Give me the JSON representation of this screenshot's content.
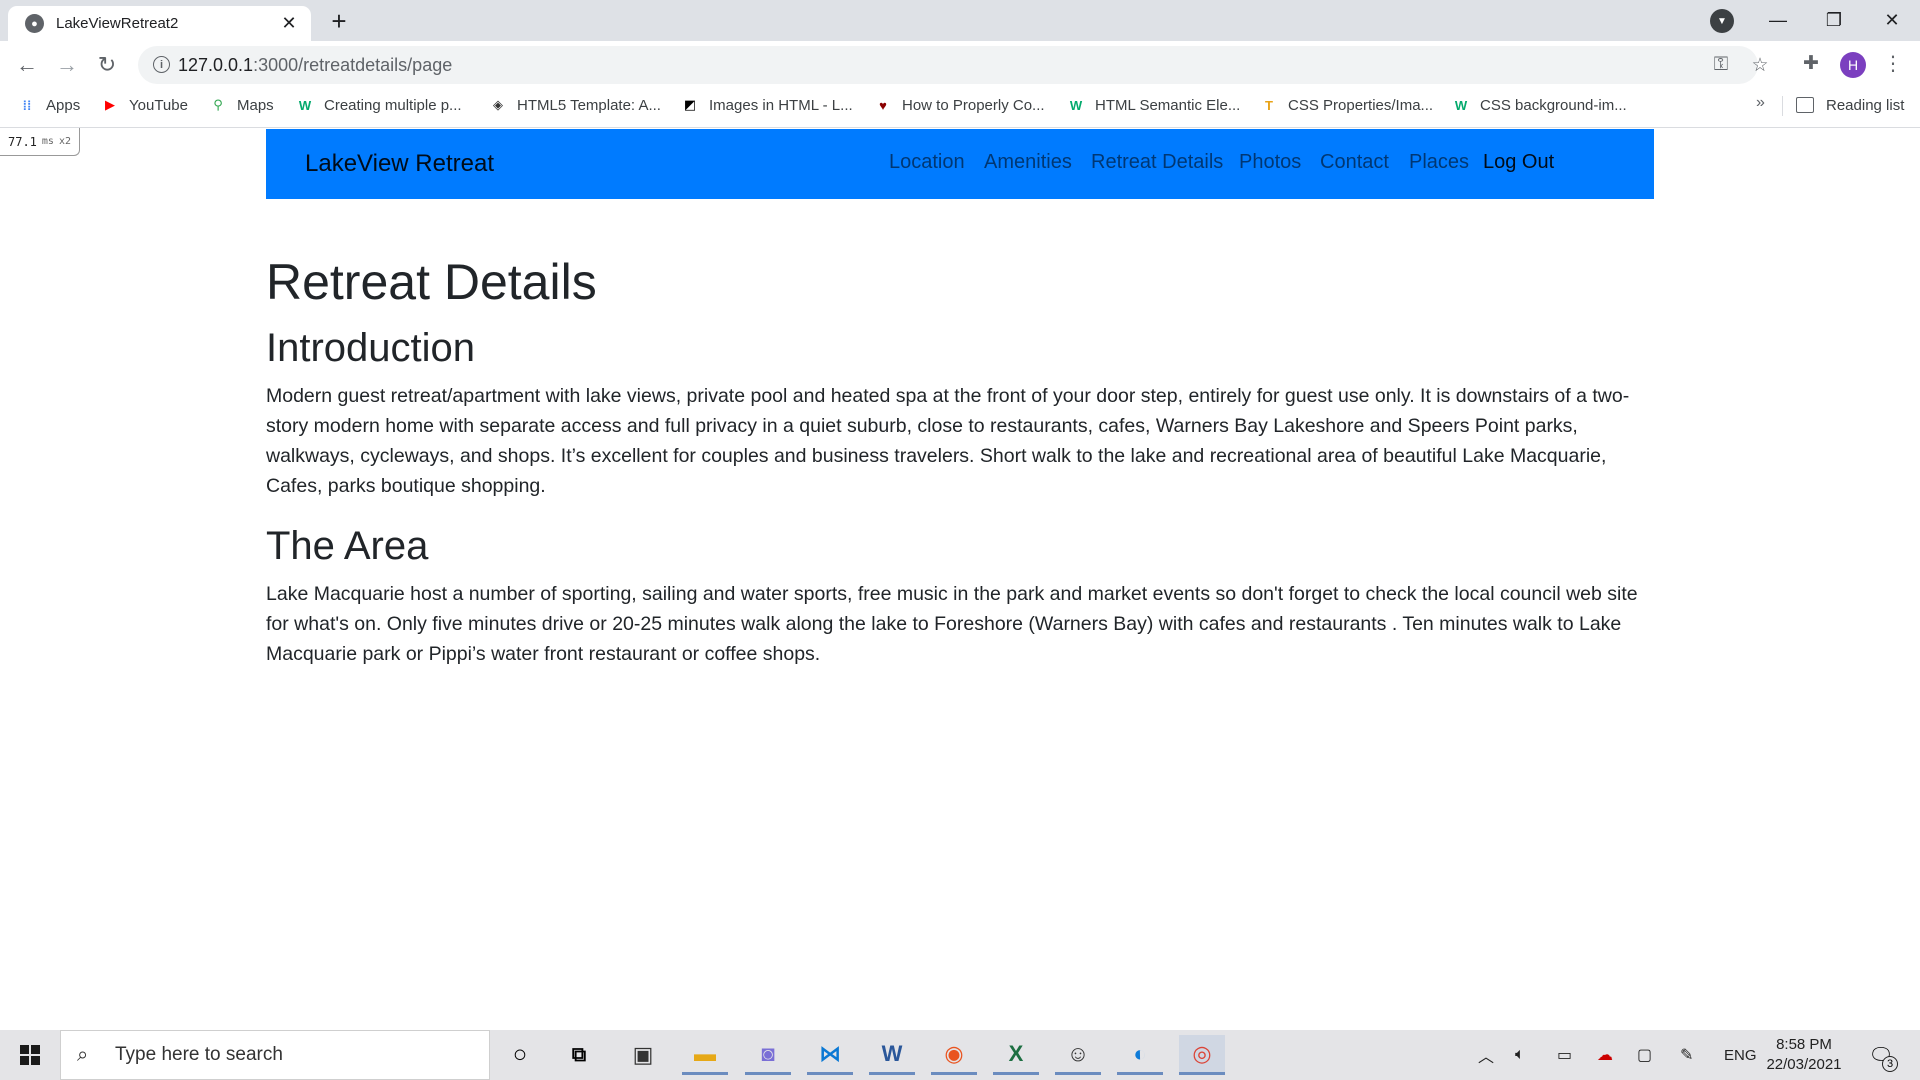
{
  "browser": {
    "tab_title": "LakeView​Retreat2",
    "url_host": "127.0.0.1",
    "url_rest": ":3000/retreatdetails/page",
    "avatar_letter": "H",
    "bookmarks": [
      {
        "label": "Apps",
        "icon": "apps-grid-icon",
        "color": "#4285f4"
      },
      {
        "label": "YouTube",
        "icon": "youtube-icon",
        "color": "#ff0000"
      },
      {
        "label": "Maps",
        "icon": "maps-pin-icon",
        "color": "#34a853"
      },
      {
        "label": "Creating multiple p...",
        "icon": "w3schools-icon",
        "color": "#04aa6d"
      },
      {
        "label": "HTML5 Template: A...",
        "icon": "sitepoint-icon",
        "color": "#333333"
      },
      {
        "label": "Images in HTML - L...",
        "icon": "mdn-icon",
        "color": "#000000"
      },
      {
        "label": "How to Properly Co...",
        "icon": "heart-icon",
        "color": "#8b0000"
      },
      {
        "label": "HTML Semantic Ele...",
        "icon": "w3schools-green-icon",
        "color": "#04aa6d"
      },
      {
        "label": "CSS Properties/Ima...",
        "icon": "tutorials-icon",
        "color": "#e8a317"
      },
      {
        "label": "CSS background-im...",
        "icon": "w3schools-green-icon",
        "color": "#04aa6d"
      }
    ],
    "reading_list": "Reading list"
  },
  "perf_badge": {
    "value": "77.1",
    "unit": "ms",
    "multiplier": "x2"
  },
  "site": {
    "brand": "LakeView Retreat",
    "nav": [
      {
        "label": "Location",
        "active": false
      },
      {
        "label": "Amenities",
        "active": false
      },
      {
        "label": "Retreat Details",
        "active": false
      },
      {
        "label": "Photos",
        "active": false
      },
      {
        "label": "Contact",
        "active": false
      },
      {
        "label": "Places",
        "active": false
      },
      {
        "label": "Log Out",
        "active": true
      }
    ],
    "accent": "#007bff"
  },
  "page": {
    "title": "Retreat Details",
    "sections": [
      {
        "heading": "Introduction",
        "text": "Modern guest retreat/apartment with lake views, private pool and heated spa at the front of your door step, entirely for guest use only. It is downstairs of a two-story modern home with separate access and full privacy in a quiet suburb, close to restaurants, cafes, Warners Bay Lakeshore and Speers Point parks, walkways, cycleways, and shops. It’s excellent for couples and business travelers. Short walk to the lake and recreational area of beautiful Lake Macquarie, Cafes, parks boutique shopping."
      },
      {
        "heading": "The Area",
        "text": "Lake Macquarie host a number of sporting, sailing and water sports, free music in the park and market events so don't forget to check the local council web site for what's on. Only five minutes drive or 20-25 minutes walk along the lake to Foreshore (Warners Bay) with cafes and restaurants . Ten minutes walk to Lake Macquarie park or Pippi’s water front restaurant or coffee shops."
      }
    ]
  },
  "taskbar": {
    "search_placeholder": "Type here to search",
    "language": "ENG",
    "time": "8:58 PM",
    "date": "22/03/2021",
    "notification_count": "3"
  }
}
